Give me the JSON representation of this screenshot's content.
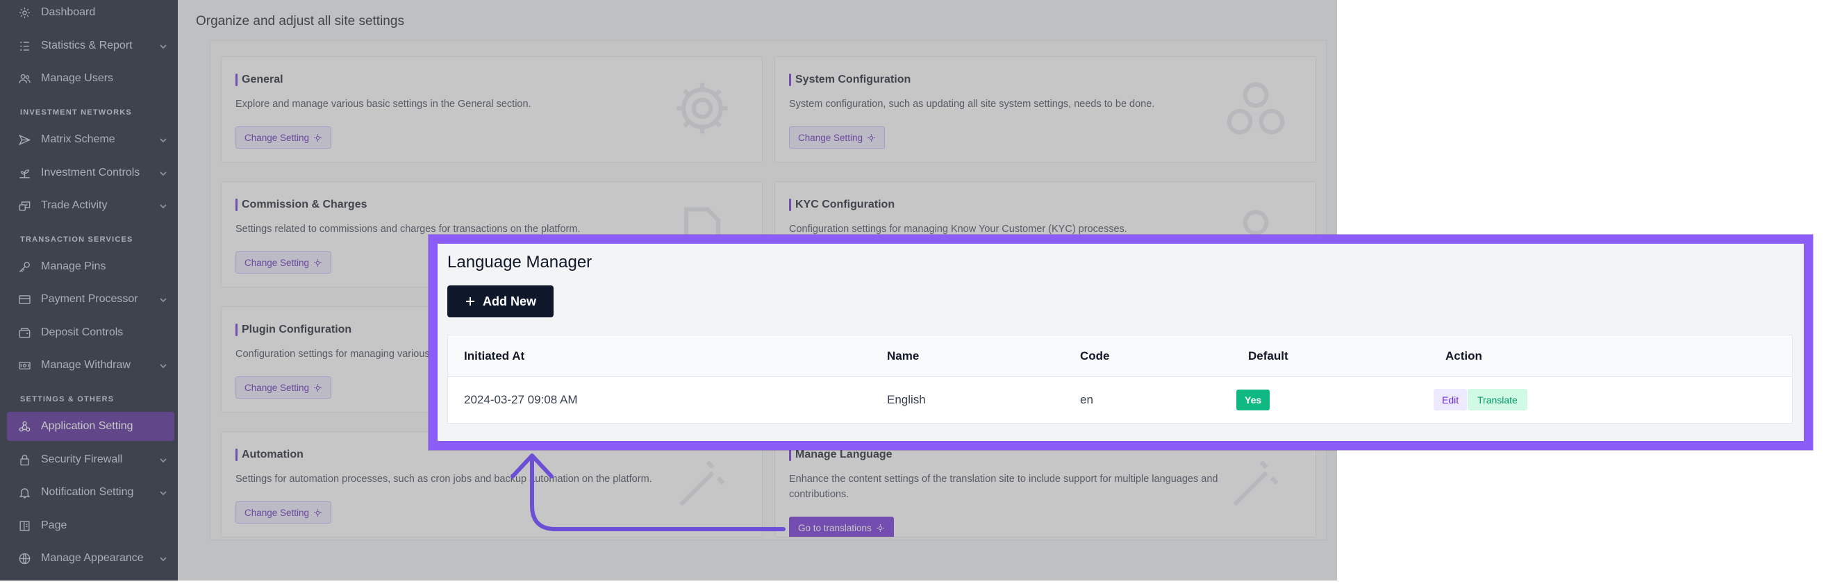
{
  "sidebar": {
    "items": [
      {
        "label": "Dashboard",
        "icon": "gear-icon"
      },
      {
        "label": "Statistics & Report",
        "icon": "list-icon"
      },
      {
        "label": "Manage Users",
        "icon": "users-icon"
      },
      {
        "label": "Matrix Scheme",
        "icon": "send-icon"
      },
      {
        "label": "Investment Controls",
        "icon": "plant-icon"
      },
      {
        "label": "Trade Activity",
        "icon": "coins-icon"
      },
      {
        "label": "Manage Pins",
        "icon": "key-icon"
      },
      {
        "label": "Payment Processor",
        "icon": "card-icon"
      },
      {
        "label": "Deposit Controls",
        "icon": "wallet-icon"
      },
      {
        "label": "Manage Withdraw",
        "icon": "cash-icon"
      },
      {
        "label": "Application Setting",
        "icon": "nodes-icon"
      },
      {
        "label": "Security Firewall",
        "icon": "lock-icon"
      },
      {
        "label": "Notification Setting",
        "icon": "bell-icon"
      },
      {
        "label": "Page",
        "icon": "pages-icon"
      },
      {
        "label": "Manage Appearance",
        "icon": "globe-icon"
      }
    ],
    "sections": {
      "investment": "INVESTMENT NETWORKS",
      "transaction": "TRANSACTION SERVICES",
      "settings": "SETTINGS & OTHERS"
    }
  },
  "main": {
    "title": "Organize and adjust all site settings",
    "cards": [
      {
        "title": "General",
        "desc": "Explore and manage various basic settings in the General section.",
        "button": "Change Setting"
      },
      {
        "title": "System Configuration",
        "desc": "System configuration, such as updating all site system settings, needs to be done.",
        "button": "Change Setting"
      },
      {
        "title": "Commission & Charges",
        "desc": "Settings related to commissions and charges for transactions on the platform.",
        "button": "Change Setting"
      },
      {
        "title": "KYC Configuration",
        "desc": "Configuration settings for managing Know Your Customer (KYC) processes.",
        "button": "Change Setting"
      },
      {
        "title": "Plugin Configuration",
        "desc": "Configuration settings for managing various",
        "button": "Change Setting"
      },
      {
        "title": "",
        "desc": "",
        "button": ""
      },
      {
        "title": "Automation",
        "desc": "Settings for automation processes, such as cron jobs and backup automation on the platform.",
        "button": "Change Setting"
      },
      {
        "title": "Manage Language",
        "desc": "Enhance the content settings of the translation site to include support for multiple languages and contributions.",
        "button": "Go to translations"
      }
    ]
  },
  "language_manager": {
    "title": "Language Manager",
    "add_button": "Add New",
    "columns": [
      "Initiated At",
      "Name",
      "Code",
      "Default",
      "Action"
    ],
    "rows": [
      {
        "initiated_at": "2024-03-27 09:08 AM",
        "name": "English",
        "code": "en",
        "default": "Yes",
        "edit": "Edit",
        "translate": "Translate"
      }
    ]
  },
  "colors": {
    "sidebar_bg": "#0f172a",
    "active_item": "#4c1d95",
    "accent": "#8b5cf6",
    "success": "#10b981"
  }
}
